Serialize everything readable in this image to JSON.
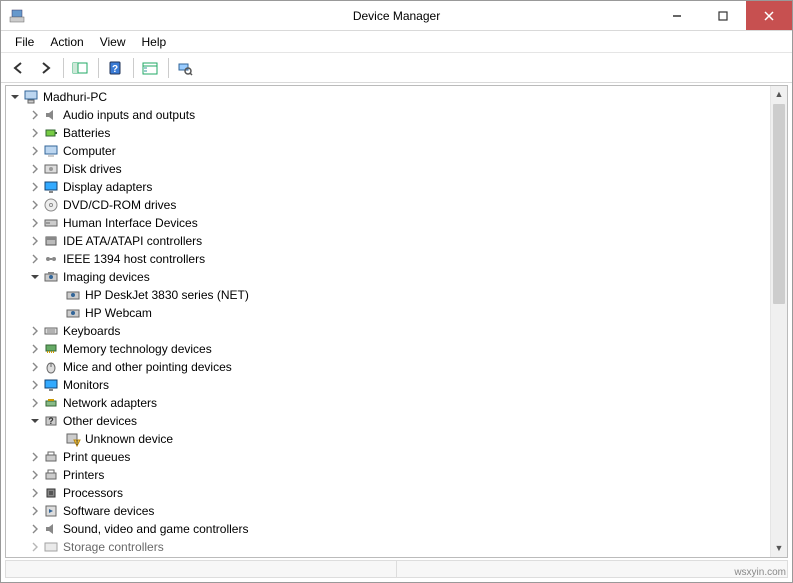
{
  "window": {
    "title": "Device Manager"
  },
  "menu": {
    "file": "File",
    "action": "Action",
    "view": "View",
    "help": "Help"
  },
  "tree": {
    "root": "Madhuri-PC",
    "nodes": [
      {
        "label": "Audio inputs and outputs"
      },
      {
        "label": "Batteries"
      },
      {
        "label": "Computer"
      },
      {
        "label": "Disk drives"
      },
      {
        "label": "Display adapters"
      },
      {
        "label": "DVD/CD-ROM drives"
      },
      {
        "label": "Human Interface Devices"
      },
      {
        "label": "IDE ATA/ATAPI controllers"
      },
      {
        "label": "IEEE 1394 host controllers"
      },
      {
        "label": "Imaging devices",
        "expanded": true
      },
      {
        "label": "Keyboards"
      },
      {
        "label": "Memory technology devices"
      },
      {
        "label": "Mice and other pointing devices"
      },
      {
        "label": "Monitors"
      },
      {
        "label": "Network adapters"
      },
      {
        "label": "Other devices",
        "expanded": true
      },
      {
        "label": "Print queues"
      },
      {
        "label": "Printers"
      },
      {
        "label": "Processors"
      },
      {
        "label": "Software devices"
      },
      {
        "label": "Sound, video and game controllers"
      },
      {
        "label": "Storage controllers"
      }
    ],
    "imaging_children": [
      "HP DeskJet 3830 series (NET)",
      "HP Webcam"
    ],
    "other_children": [
      "Unknown device"
    ]
  },
  "watermark": "wsxyin.com"
}
